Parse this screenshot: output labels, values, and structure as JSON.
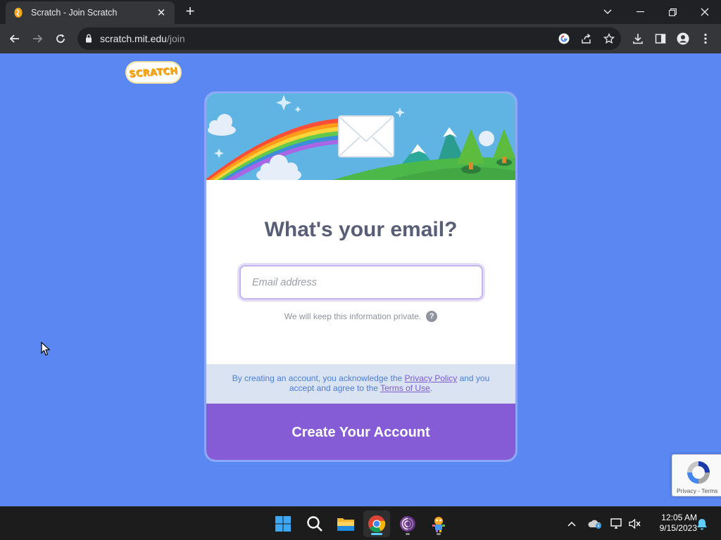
{
  "browser": {
    "tab_title": "Scratch - Join Scratch",
    "new_tab_label": "+",
    "url_host": "scratch.mit.edu",
    "url_path": "/join"
  },
  "page": {
    "logo_text": "SCRATCH",
    "heading": "What's your email?",
    "email": {
      "value": "",
      "placeholder": "Email address"
    },
    "privacy_note": "We will keep this information private.",
    "help_glyph": "?",
    "legal": {
      "prefix": "By creating an account, you acknowledge the ",
      "privacy_link": "Privacy Policy",
      "middle": " and you accept and agree to the ",
      "terms_link": "Terms of Use",
      "suffix": "."
    },
    "create_button": "Create Your Account"
  },
  "recaptcha": {
    "links": "Privacy - Terms"
  },
  "taskbar": {
    "time": "12:05 AM",
    "date": "9/15/2023",
    "apps": [
      "windows-start",
      "search",
      "file-explorer",
      "chrome",
      "tor-browser",
      "scratch-app"
    ]
  },
  "colors": {
    "page_bg": "#5b87f2",
    "button_purple": "#855cd6",
    "heading_text": "#575e75",
    "legal_bg": "#d9e3f2"
  }
}
